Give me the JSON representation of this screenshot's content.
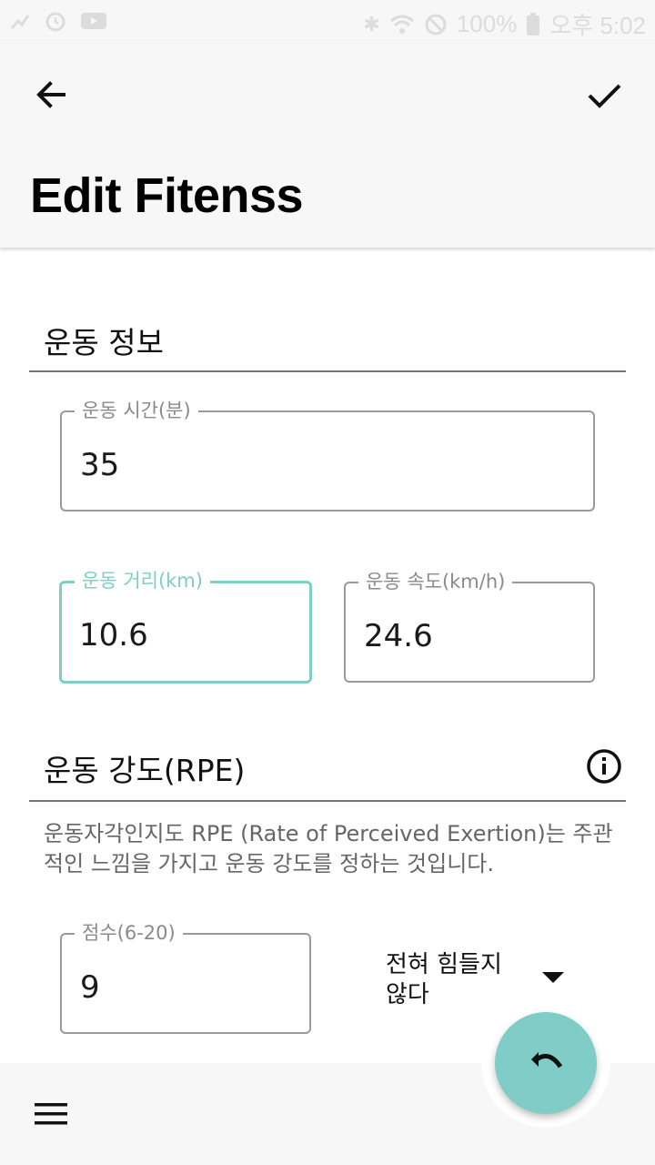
{
  "status_bar": {
    "battery": "100%",
    "time": "오후 5:02"
  },
  "app_bar": {
    "title": "Edit Fitenss",
    "back_icon": "arrow-back-icon",
    "confirm_icon": "check-icon"
  },
  "exercise_info": {
    "section_title": "운동 정보",
    "duration": {
      "label": "운동 시간(분)",
      "value": "35"
    },
    "distance": {
      "label": "운동 거리(km)",
      "value": "10.6"
    },
    "speed": {
      "label": "운동 속도(km/h)",
      "value": "24.6"
    }
  },
  "intensity": {
    "section_title": "운동 강도(RPE)",
    "info_icon": "info-icon",
    "description": "운동자각인지도 RPE (Rate of Perceived Exertion)는 주관적인 느낌을 가지고 운동 강도를 정하는 것입니다.",
    "score": {
      "label": "점수(6-20)",
      "value": "9"
    },
    "level_select": {
      "selected": "전혀 힘들지 않다"
    }
  },
  "bottom_bar": {
    "menu_icon": "menu-icon",
    "fab_icon": "undo-icon"
  },
  "colors": {
    "accent": "#7fcdc6",
    "bar_background": "#f7f7f7"
  }
}
